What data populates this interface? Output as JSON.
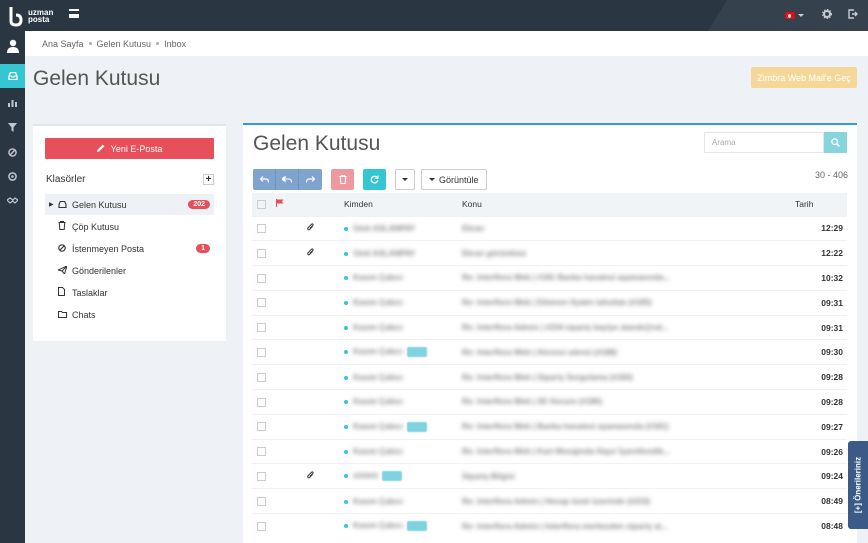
{
  "topbar": {
    "logo_line1": "uzman",
    "logo_line2": "posta",
    "icons": [
      "turkey-flag-icon",
      "gear-icon",
      "logout-icon"
    ]
  },
  "rail": {
    "icons": [
      "user-icon",
      "inbox-icon",
      "chart-icon",
      "filter-icon",
      "block-icon",
      "lifebuoy-icon",
      "handshake-icon"
    ]
  },
  "breadcrumb": [
    "Ana Sayfa",
    "Gelen Kutusu",
    "Inbox"
  ],
  "page_title": "Gelen Kutusu",
  "zimbra_button": "Zimbra Web Mail'e Geç",
  "left": {
    "new_mail": "Yeni E-Posta",
    "folders_title": "Klasörler",
    "folders": [
      {
        "label": "Gelen Kutusu",
        "badge": "202",
        "icon": "inbox-icon"
      },
      {
        "label": "Çöp Kutusu",
        "badge": "",
        "icon": "trash-icon"
      },
      {
        "label": "İstenmeyen Posta",
        "badge": "1",
        "icon": "block-icon"
      },
      {
        "label": "Gönderilenler",
        "badge": "",
        "icon": "send-icon"
      },
      {
        "label": "Taslaklar",
        "badge": "",
        "icon": "file-icon"
      },
      {
        "label": "Chats",
        "badge": "",
        "icon": "folder-icon"
      }
    ]
  },
  "main": {
    "title": "Gelen Kutusu",
    "search_placeholder": "Arama",
    "view_button": "Görüntüle",
    "paging": "30 - 406",
    "columns": {
      "from": "Kimden",
      "subject": "Konu",
      "date": "Tarih"
    },
    "rows": [
      {
        "attach": true,
        "from": "Ümit ASLANPAY",
        "tag": false,
        "subject": "Ekran",
        "time": "12:29"
      },
      {
        "attach": true,
        "from": "Ümit ASLANPAY",
        "tag": false,
        "subject": "Ekran görüntüsü",
        "time": "12:22"
      },
      {
        "attach": false,
        "from": "Kasım Çakıcı",
        "tag": false,
        "subject": "Re: Interflora Web | #181 Banka havalesi aşamasında...",
        "time": "10:32"
      },
      {
        "attach": false,
        "from": "Kasım Çakıcı",
        "tag": false,
        "subject": "Re: Interflora Web | Eklenen fiyatın tahsilatı (#185)",
        "time": "09:31"
      },
      {
        "attach": false,
        "from": "Kasım Çakıcı",
        "tag": false,
        "subject": "Re: Interflora Admin | #234 sipariş bayiye atandı@nd...",
        "time": "09:31"
      },
      {
        "attach": false,
        "from": "Kasım Çakıcı",
        "tag": true,
        "subject": "Re: Interflora Web | Alıcının adresi (#188)",
        "time": "09:30"
      },
      {
        "attach": false,
        "from": "Kasım Çakıcı",
        "tag": false,
        "subject": "Re: Interflora Web | Sipariş Sorgulama (#183)",
        "time": "09:28"
      },
      {
        "attach": false,
        "from": "Kasım Çakıcı",
        "tag": false,
        "subject": "Re: Interflora Web | 3D Secure (#180)",
        "time": "09:28"
      },
      {
        "attach": false,
        "from": "Kasım Çakıcı",
        "tag": true,
        "subject": "Re: Interflora Web | Banka havalesi aşamasında (#181)",
        "time": "09:27"
      },
      {
        "attach": false,
        "from": "Kasım Çakıcı",
        "tag": false,
        "subject": "Re: Interflora Web | Kart Mesajında Hayır İşaretlendik...",
        "time": "09:26"
      },
      {
        "attach": true,
        "from": "sistem",
        "tag": true,
        "subject": "Sipariş Bilgisi",
        "time": "09:24"
      },
      {
        "attach": false,
        "from": "Kasım Çakıcı",
        "tag": false,
        "subject": "Re: Interflora Admin | Hesap özeti üzerinde (#233)",
        "time": "08:49"
      },
      {
        "attach": false,
        "from": "Kasım Çakıcı",
        "tag": true,
        "subject": "Re: Interflora Admin | Interflora merkezden sipariş al...",
        "time": "08:48"
      }
    ]
  },
  "suggest": "[+] Önerileriniz"
}
